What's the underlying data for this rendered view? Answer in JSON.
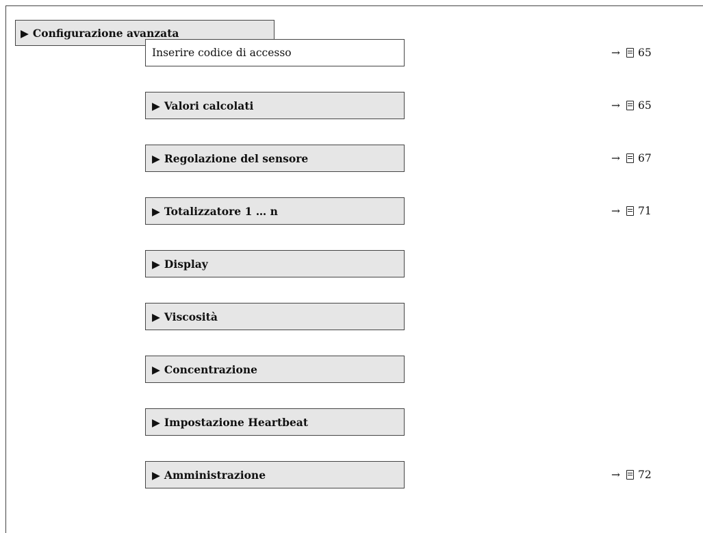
{
  "header": {
    "arrow": "▶",
    "label": "Configurazione avanzata"
  },
  "rows": [
    {
      "type": "param",
      "label": "Inserire codice di accesso",
      "ref": "65"
    },
    {
      "type": "submenu",
      "arrow": "▶",
      "label": "Valori calcolati",
      "ref": "65"
    },
    {
      "type": "submenu",
      "arrow": "▶",
      "label": "Regolazione del sensore",
      "ref": "67"
    },
    {
      "type": "submenu",
      "arrow": "▶",
      "label": "Totalizzatore 1 … n",
      "ref": "71"
    },
    {
      "type": "submenu",
      "arrow": "▶",
      "label": "Display",
      "ref": ""
    },
    {
      "type": "submenu",
      "arrow": "▶",
      "label": "Viscosità",
      "ref": ""
    },
    {
      "type": "submenu",
      "arrow": "▶",
      "label": "Concentrazione",
      "ref": ""
    },
    {
      "type": "submenu",
      "arrow": "▶",
      "label": "Impostazione Heartbeat",
      "ref": ""
    },
    {
      "type": "submenu",
      "arrow": "▶",
      "label": "Amministrazione",
      "ref": "72"
    }
  ],
  "ref_arrow": "→",
  "icons": {
    "page_reference": "page-reference-icon"
  }
}
